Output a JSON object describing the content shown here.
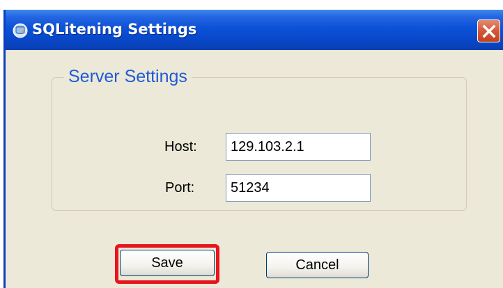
{
  "window": {
    "title": "SQLitening Settings",
    "title_icon": "sqlitening-app-icon",
    "close_icon": "close-icon"
  },
  "server_settings": {
    "group_title": "Server Settings",
    "host": {
      "label": "Host:",
      "value": "129.103.2.1"
    },
    "port": {
      "label": "Port:",
      "value": "51234"
    }
  },
  "buttons": {
    "save_label": "Save",
    "cancel_label": "Cancel"
  },
  "colors": {
    "titlebar": "#0b52d9",
    "dialog_background": "#ece9d8",
    "group_title": "#1f5ad6",
    "highlight": "#e8141c",
    "close_button": "#d4573a"
  }
}
